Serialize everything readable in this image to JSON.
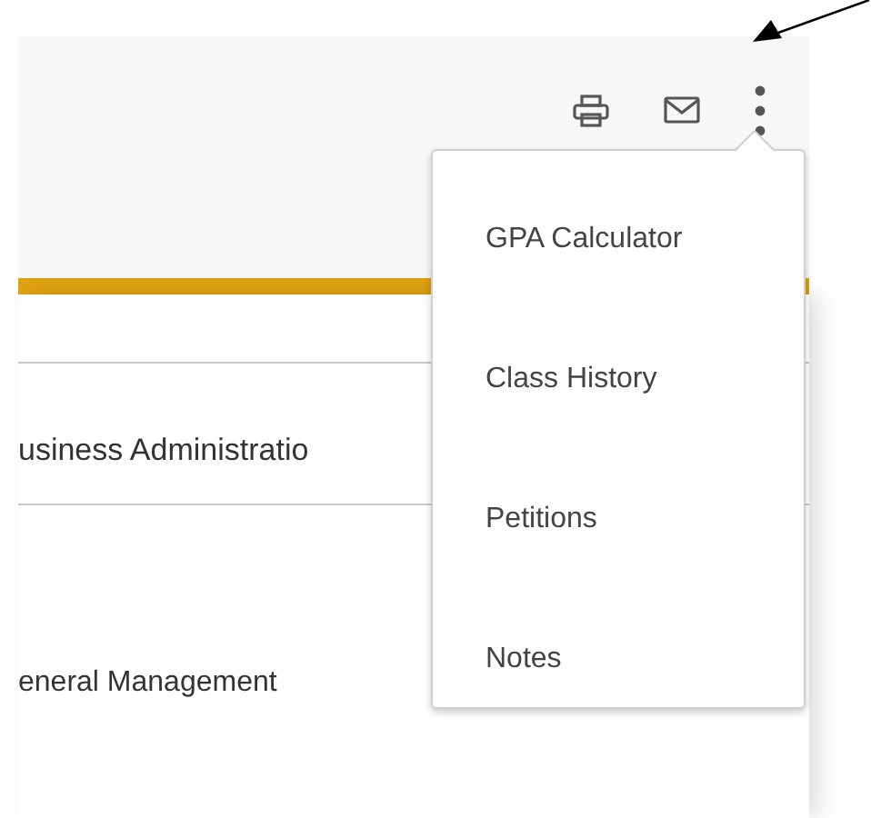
{
  "toolbar": {
    "actions": [
      {
        "kind": "print"
      },
      {
        "kind": "mail"
      },
      {
        "kind": "more",
        "expanded": true
      }
    ]
  },
  "content": {
    "program": "usiness Administratio",
    "concentration": "eneral Management"
  },
  "menu": {
    "items": [
      {
        "label": "GPA Calculator"
      },
      {
        "label": "Class History"
      },
      {
        "label": "Petitions"
      },
      {
        "label": "Notes"
      }
    ]
  }
}
